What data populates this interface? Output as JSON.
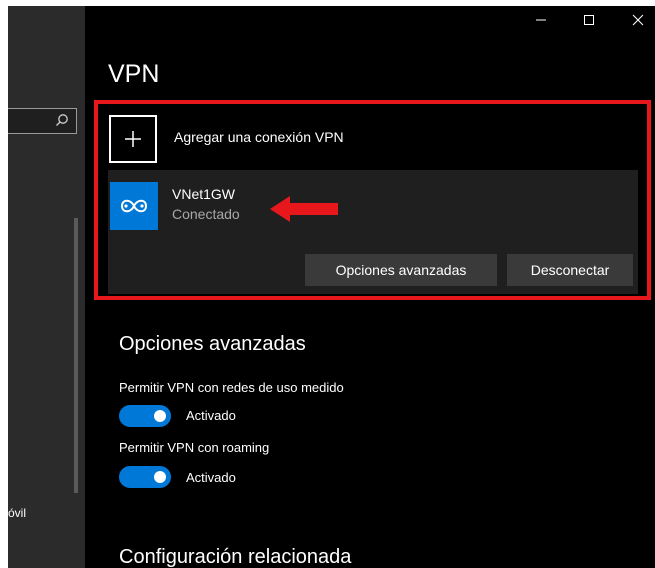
{
  "window": {
    "minimize_label": "",
    "maximize_label": "",
    "close_label": ""
  },
  "nav": {
    "search": {
      "value": "",
      "icon": "search-icon"
    },
    "partial_item_label": "óvil"
  },
  "page": {
    "title": "VPN"
  },
  "add_connection": {
    "label": "Agregar una conexión VPN",
    "icon": "plus-icon"
  },
  "connection": {
    "name": "VNet1GW",
    "status": "Conectado",
    "icon": "vpn-network-icon",
    "advanced_button": "Opciones avanzadas",
    "disconnect_button": "Desconectar"
  },
  "advanced": {
    "title": "Opciones avanzadas",
    "metered": {
      "label": "Permitir VPN con redes de uso medido",
      "state": "Activado",
      "on": true
    },
    "roaming": {
      "label": "Permitir VPN con roaming",
      "state": "Activado",
      "on": true
    }
  },
  "related": {
    "title": "Configuración relacionada"
  },
  "colors": {
    "background": "#000000",
    "accent": "#0078d7",
    "highlight": "#e8171c",
    "card": "#1f1f1f",
    "button": "#3a3a3a",
    "muted_text": "#a8a8a8"
  }
}
